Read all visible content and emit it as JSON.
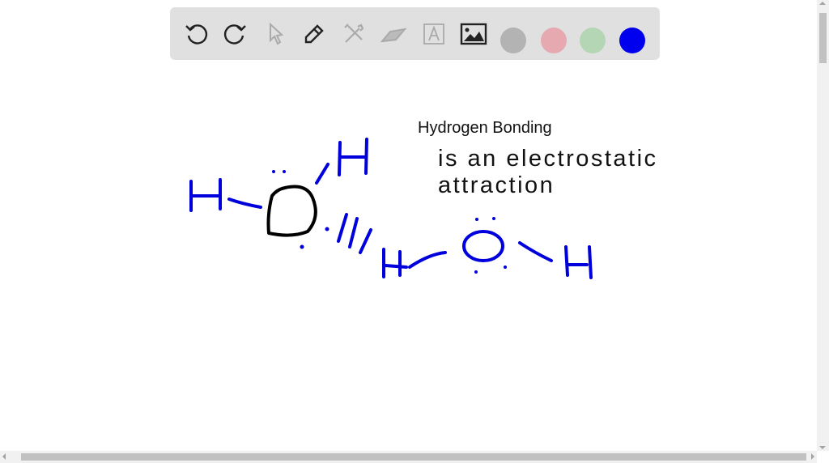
{
  "toolbar": {
    "tools": [
      "undo-icon",
      "redo-icon",
      "select-icon",
      "pen-icon",
      "tools-icon",
      "eraser-icon",
      "text-icon",
      "image-icon"
    ],
    "colors": [
      "#b3b3b3",
      "#e6a9b0",
      "#b5d6b5",
      "#0000ee"
    ],
    "selected_color": "#0000ee"
  },
  "canvas": {
    "title": "Hydrogen Bonding",
    "line1": "is an electrostatic",
    "line2": "attraction",
    "ink_color": "#0000dd"
  }
}
